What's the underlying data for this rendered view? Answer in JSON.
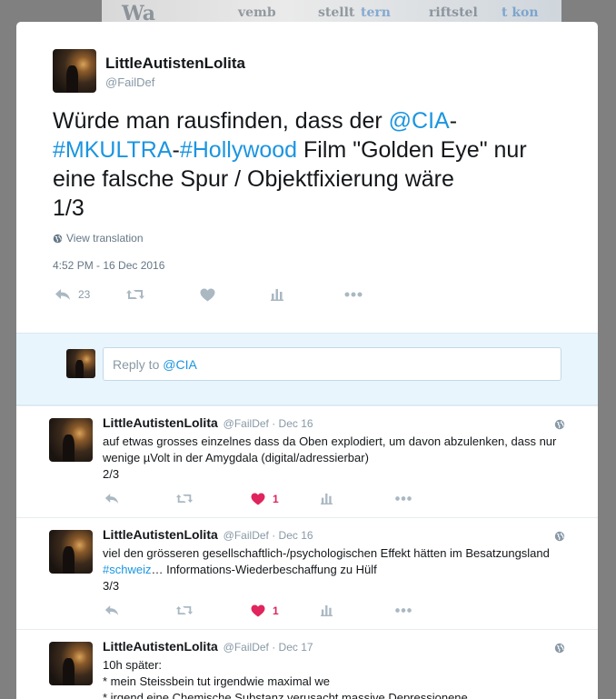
{
  "background": {
    "fragment_1": "Wa",
    "fragment_2": "vemb",
    "fragment_3": "stellt",
    "fragment_4": "tern",
    "fragment_5": "riftstel",
    "fragment_6": "t kon"
  },
  "main_tweet": {
    "display_name": "LittleAutistenLolita",
    "handle": "@FailDef",
    "text_parts": {
      "p1": "Würde man rausfinden, dass der ",
      "mention": "@CIA",
      "p2": "-",
      "hashtag1": "#MKULTRA",
      "p3": "-",
      "hashtag2": "#Hollywood",
      "p4": " Film \"Golden Eye\" nur eine falsche Spur / Objektfixierung wäre",
      "p5": "1/3"
    },
    "view_translation": "View translation",
    "timestamp": "4:52 PM - 16 Dec 2016",
    "reply_count": "23"
  },
  "reply_box": {
    "prefix": "Reply to ",
    "mention": "@CIA"
  },
  "replies": [
    {
      "display_name": "LittleAutistenLolita",
      "meta": "@FailDef · Dec 16",
      "text_a": "auf etwas grosses einzelnes dass da Oben explodiert, um davon abzulenken, dass nur wenige µVolt in der Amygdala (digital/adressierbar)",
      "text_b": "2/3",
      "like_count": "1"
    },
    {
      "display_name": "LittleAutistenLolita",
      "meta": "@FailDef · Dec 16",
      "text_a": "viel den grösseren gesellschaftlich-/psychologischen Effekt hätten im Besatzungsland ",
      "hashtag": "#schweiz",
      "text_c": "… Informations-Wiederbeschaffung zu Hülf",
      "text_b": "3/3",
      "like_count": "1"
    },
    {
      "display_name": "LittleAutistenLolita",
      "meta": "@FailDef · Dec 17",
      "line1": "10h später:",
      "line2": "* mein Steissbein tut irgendwie maximal we",
      "line3": "* irgend eine Chemische Substanz verusacht massive Depressionene"
    }
  ],
  "colors": {
    "link": "#1b95e0",
    "like": "#e0245e",
    "icon": "#aab8c2"
  }
}
